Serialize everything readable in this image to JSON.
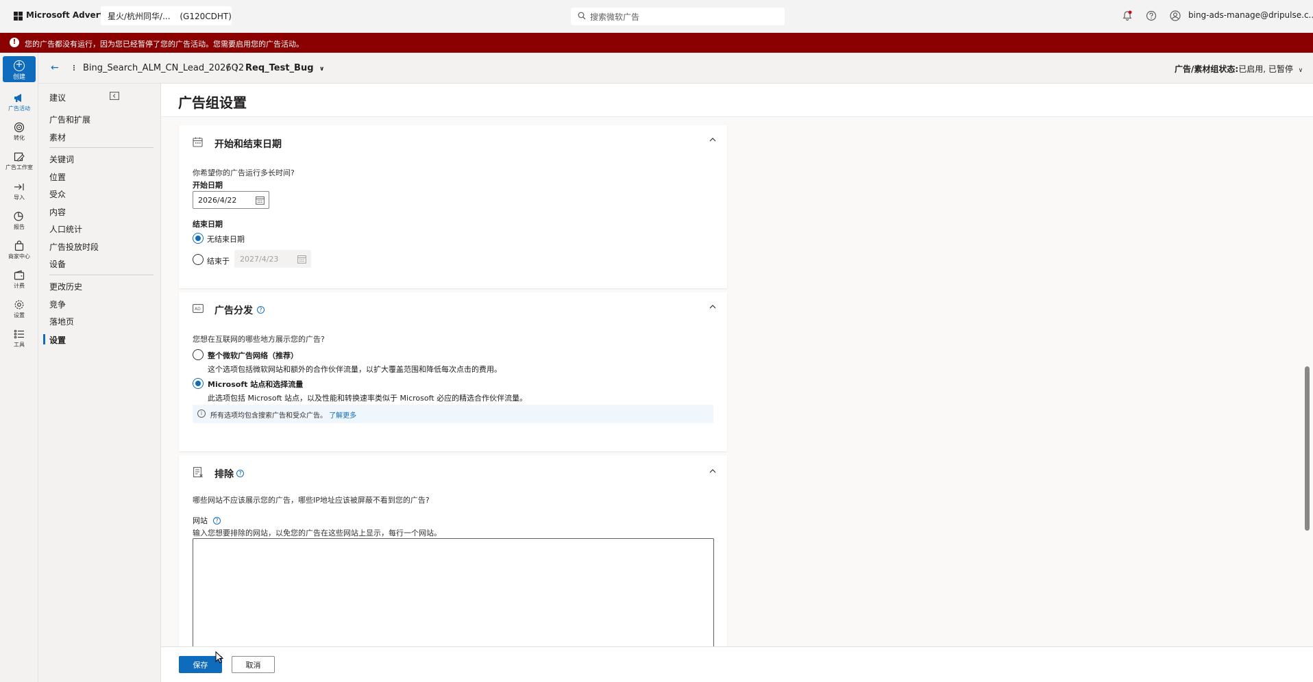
{
  "topbar": {
    "brand": "Microsoft Advertising",
    "account": "星火/杭州同华/...",
    "account_id": "(G120CDHT)",
    "search_placeholder": "搜索微软广告",
    "user_email": "bing-ads-manage@dripulse.c..."
  },
  "banner": {
    "text": "您的广告都没有运行，因为您已经暂停了您的广告活动。您需要启用您的广告活动。"
  },
  "rail": {
    "create": "创建",
    "items": [
      "广告活动",
      "转化",
      "广告工作室",
      "导入",
      "报告",
      "商家中心",
      "计费",
      "设置",
      "工具"
    ]
  },
  "subnav": {
    "items": [
      "建议",
      "广告和扩展",
      "素材",
      "关键词",
      "位置",
      "受众",
      "内容",
      "人口统计",
      "广告投放时段",
      "设备",
      "更改历史",
      "竞争",
      "落地页",
      "设置"
    ]
  },
  "breadcrumb": {
    "campaign": "Bing_Search_ALM_CN_Lead_2026Q2",
    "separator": "/",
    "adgroup": "Req_Test_Bug",
    "status_label": "广告/素材组状态:",
    "status_value": "已启用, 已暂停"
  },
  "page": {
    "title": "广告组设置"
  },
  "dates_card": {
    "title": "开始和结束日期",
    "question": "你希望你的广告运行多长时间?",
    "start_label": "开始日期",
    "start_value": "2026/4/22",
    "end_label": "结束日期",
    "no_end": "无结束日期",
    "end_on": "结束于",
    "end_value": "2027/4/23"
  },
  "distribution_card": {
    "title": "广告分发",
    "question": "您想在互联网的哪些地方展示您的广告?",
    "option1_label": "整个微软广告网络（推荐）",
    "option1_desc": "这个选项包括微软网站和额外的合作伙伴流量，以扩大覆盖范围和降低每次点击的费用。",
    "option2_label": "Microsoft 站点和选择流量",
    "option2_desc": "此选项包括 Microsoft 站点，以及性能和转换速率类似于 Microsoft 必应的精选合作伙伴流量。",
    "info_text": "所有选项均包含搜索广告和受众广告。",
    "info_link": "了解更多"
  },
  "exclusions_card": {
    "title": "排除",
    "question": "哪些网站不应该展示您的广告，哪些IP地址应该被屏蔽不看到您的广告?",
    "website_label": "网站",
    "website_hint": "输入您想要排除的网站，以免您的广告在这些网站上显示，每行一个网站。",
    "website_value": ""
  },
  "footer": {
    "save": "保存",
    "cancel": "取消"
  },
  "colors": {
    "accent": "#0f6cbd",
    "banner": "#8b0000"
  }
}
